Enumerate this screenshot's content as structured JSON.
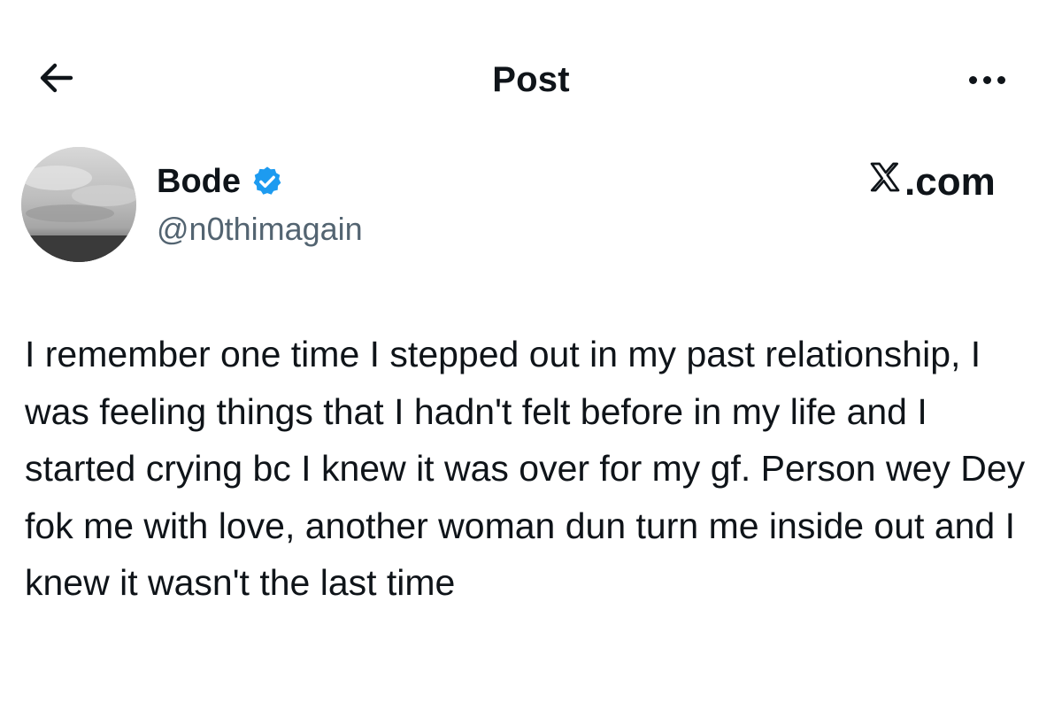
{
  "header": {
    "back_icon": "arrow-left-icon",
    "title": "Post",
    "more_icon": "more-horizontal-icon"
  },
  "author": {
    "display_name": "Bode",
    "verified_icon": "verified-badge-icon",
    "verified_color": "#1d9bf0",
    "handle": "@n0thimagain",
    "avatar_icon": "cloudy-sky-avatar"
  },
  "watermark": {
    "logo_icon": "x-logo-icon",
    "text": ".com"
  },
  "post": {
    "text": "I remember one time I stepped out in my past relationship, I was feeling things that I hadn't felt before in my life and I started crying bc I knew it was over for my gf. Person wey Dey fok me with love, another woman dun turn me inside out and I knew it wasn't the last time"
  },
  "colors": {
    "text_primary": "#0f1419",
    "text_secondary": "#536471",
    "background": "#ffffff"
  }
}
